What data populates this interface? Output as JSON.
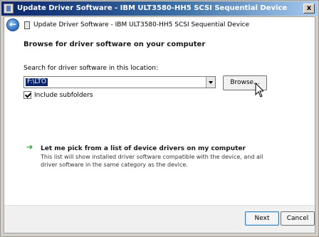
{
  "window": {
    "title": "Update Driver Software - IBM ULT3580-HH5 SCSI Sequential Device",
    "close_label": "x"
  },
  "nav": {
    "back_label": "←",
    "title": "Update Driver Software - IBM ULT3580-HH5 SCSI Sequential Device"
  },
  "main": {
    "heading": "Browse for driver software on your computer",
    "search_label": "Search for driver software in this location:",
    "search_value": "F:\\LTO",
    "browse_label": "Browse...",
    "include_subfolders_label": "Include subfolders",
    "include_subfolders_checked": true,
    "pick_arrow": "➔",
    "pick_link": "Let me pick from a list of device drivers on my computer",
    "pick_description": "This list will show installed driver software compatible with the device, and all driver software in the same category as the device."
  },
  "footer": {
    "next_label": "Next",
    "cancel_label": "Cancel"
  },
  "colors": {
    "title_bar": "#0a246a",
    "link_arrow": "#2e9e2e",
    "selection": "#0a246a"
  }
}
